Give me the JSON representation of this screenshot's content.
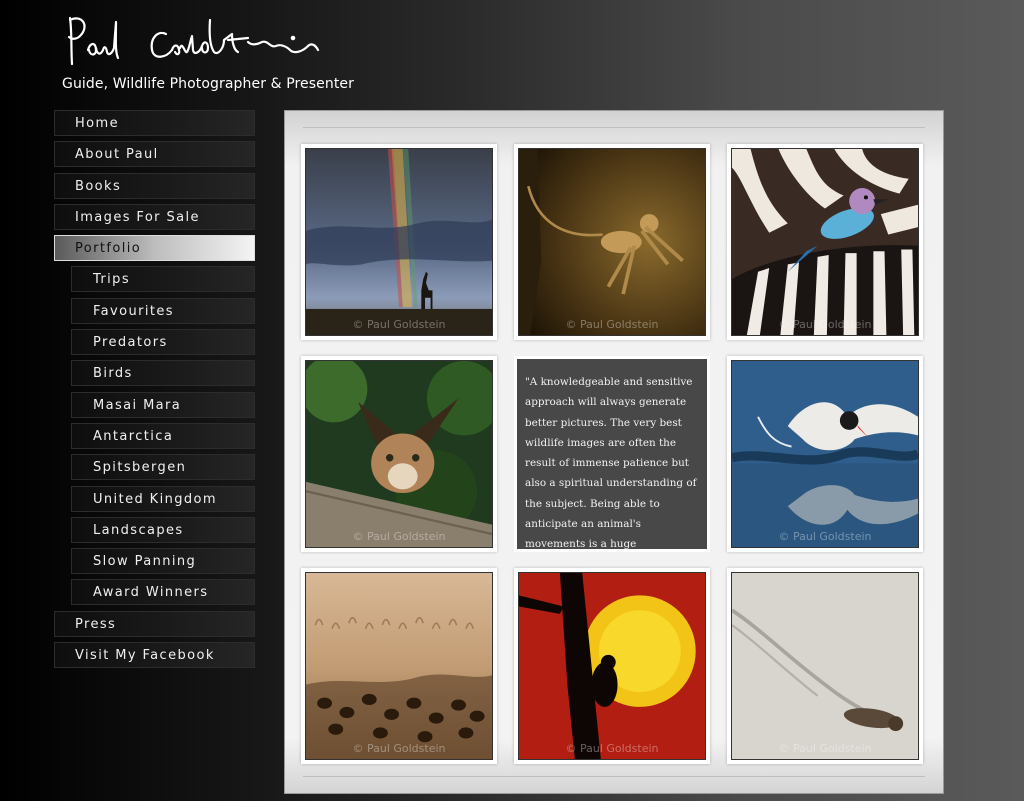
{
  "header": {
    "signature": "Paul Goldstein",
    "tagline": "Guide, Wildlife Photographer & Presenter"
  },
  "nav": {
    "items": [
      {
        "label": "Home",
        "sub": false,
        "active": false
      },
      {
        "label": "About Paul",
        "sub": false,
        "active": false
      },
      {
        "label": "Books",
        "sub": false,
        "active": false
      },
      {
        "label": "Images For Sale",
        "sub": false,
        "active": false
      },
      {
        "label": "Portfolio",
        "sub": false,
        "active": true
      },
      {
        "label": "Trips",
        "sub": true,
        "active": false
      },
      {
        "label": "Favourites",
        "sub": true,
        "active": false
      },
      {
        "label": "Predators",
        "sub": true,
        "active": false
      },
      {
        "label": "Birds",
        "sub": true,
        "active": false
      },
      {
        "label": "Masai Mara",
        "sub": true,
        "active": false
      },
      {
        "label": "Antarctica",
        "sub": true,
        "active": false
      },
      {
        "label": "Spitsbergen",
        "sub": true,
        "active": false
      },
      {
        "label": "United Kingdom",
        "sub": true,
        "active": false
      },
      {
        "label": "Landscapes",
        "sub": true,
        "active": false
      },
      {
        "label": "Slow Panning",
        "sub": true,
        "active": false
      },
      {
        "label": "Award Winners",
        "sub": true,
        "active": false
      },
      {
        "label": "Press",
        "sub": false,
        "active": false
      },
      {
        "label": "Visit My Facebook",
        "sub": false,
        "active": false
      }
    ]
  },
  "gallery": {
    "watermark": "© Paul Goldstein",
    "quote": "\"A knowledgeable and sensitive approach will always generate better pictures. The very best wildlife images are often the result of immense patience but also a spiritual understanding of the subject. Being able to anticipate an animal's movements is a huge advantage.\""
  },
  "colors": {
    "background_dark": "#000000",
    "background_light": "#5a5a5a",
    "nav_active": "#f4f4f4",
    "panel": "#f1f1f1",
    "quote_bg": "#484848"
  }
}
